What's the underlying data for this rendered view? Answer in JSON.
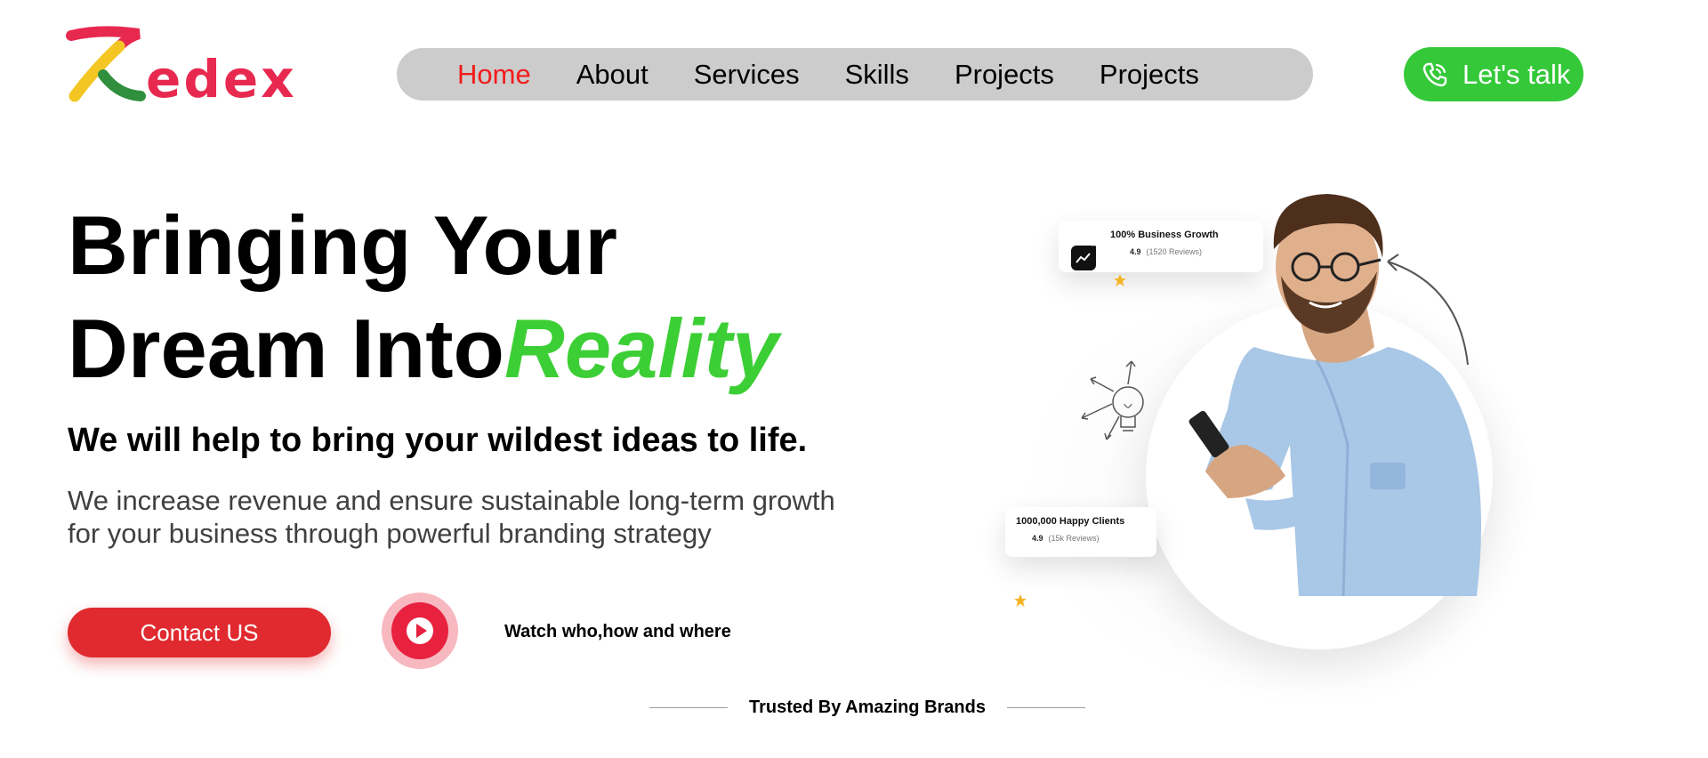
{
  "brand": {
    "logo_text": "edex",
    "logo_color": "#e8294f"
  },
  "nav": {
    "items": [
      {
        "label": "Home",
        "active": true
      },
      {
        "label": "About"
      },
      {
        "label": "Services"
      },
      {
        "label": "Skills"
      },
      {
        "label": "Projects"
      },
      {
        "label": "Projects"
      }
    ],
    "active_color": "#f21b1b"
  },
  "cta_talk": {
    "label": "Let's talk",
    "icon": "phone-icon",
    "color": "#35c93a"
  },
  "hero": {
    "line1": "Bringing Your",
    "line2_prefix": "Dream Into",
    "line2_accent": "Reality",
    "accent_color": "#3ccf35",
    "subheading": "We will help to bring your wildest ideas to life.",
    "description": "We increase revenue and ensure sustainable long-term growth for your business through powerful branding strategy",
    "contact_button": "Contact US",
    "watch_text": "Watch who,how and where",
    "trusted_text": "Trusted By Amazing Brands"
  },
  "cards": {
    "growth": {
      "title": "100% Business Growth",
      "rating": "4.9",
      "reviews": "(1520 Reviews)"
    },
    "clients": {
      "title": "1000,000 Happy Clients",
      "rating": "4.9",
      "reviews": "(15k Reviews)"
    }
  }
}
